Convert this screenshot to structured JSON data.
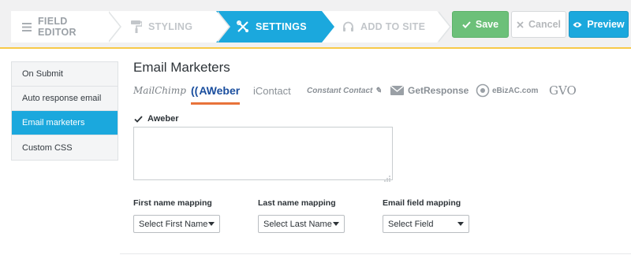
{
  "steps": [
    {
      "label": "FIELD EDITOR",
      "icon": "menu-lines-icon"
    },
    {
      "label": "STYLING",
      "icon": "paint-roller-icon"
    },
    {
      "label": "SETTINGS",
      "icon": "wrench-screwdriver-icon"
    },
    {
      "label": "ADD TO SITE",
      "icon": "headset-icon"
    }
  ],
  "toolbar": {
    "save_label": "Save",
    "cancel_label": "Cancel",
    "preview_label": "Preview"
  },
  "sidebar": {
    "items": [
      {
        "label": "On Submit"
      },
      {
        "label": "Auto response email"
      },
      {
        "label": "Email marketers"
      },
      {
        "label": "Custom CSS"
      }
    ]
  },
  "main": {
    "title": "Email Marketers",
    "providers": [
      "MailChimp",
      "AWeber",
      "iContact",
      "Constant Contact",
      "GetResponse",
      "eBizAC.com",
      "GVO"
    ],
    "selected_provider": "AWeber",
    "checkbox_label": "Aweber",
    "checkbox_checked": true,
    "textarea_value": "",
    "mappings": [
      {
        "label": "First name mapping",
        "selected": "Select First Name"
      },
      {
        "label": "Last name mapping",
        "selected": "Select Last Name"
      },
      {
        "label": "Email field mapping",
        "selected": "Select Field"
      }
    ]
  },
  "colors": {
    "accent_blue": "#1ba8dd",
    "save_green": "#6cc079",
    "header_border_yellow": "#f7c948",
    "active_underline_orange": "#e8733a"
  }
}
